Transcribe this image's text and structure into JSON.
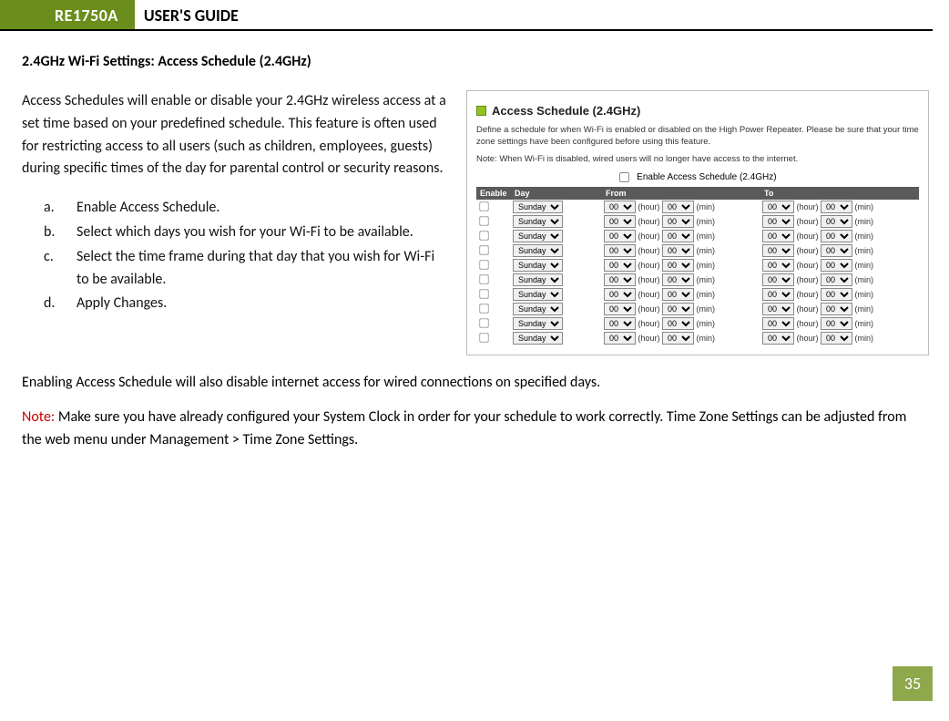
{
  "header": {
    "model": "RE1750A",
    "title": "USER'S GUIDE"
  },
  "section_heading": "2.4GHz Wi-Fi Settings: Access Schedule (2.4GHz)",
  "intro": "Access Schedules will enable or disable your 2.4GHz wireless access at a set time based on your predefined schedule.  This feature is often used for restricting access to all users (such as children, employees, guests) during specific times of the day for parental control or security reasons.",
  "steps": [
    {
      "marker": "a.",
      "text": "Enable Access Schedule."
    },
    {
      "marker": "b.",
      "text": "Select which days you wish for your Wi-Fi to be available."
    },
    {
      "marker": "c.",
      "text": "Select the time frame during that day that you wish for Wi-Fi to be available."
    },
    {
      "marker": "d.",
      "text": "Apply Changes."
    }
  ],
  "lower1": "Enabling Access Schedule will also disable internet access for wired connections on specified days.",
  "note_prefix": "Note:",
  "lower2": "  Make sure you have already configured your System Clock in order for your schedule to work correctly. Time Zone Settings can be adjusted from the web menu under Management > Time Zone Settings.",
  "figure": {
    "title": "Access Schedule (2.4GHz)",
    "desc": "Define a schedule for when Wi-Fi is enabled or disabled on the High Power Repeater. Please be sure that your time zone settings have been configured before using this feature.",
    "note": "Note: When Wi-Fi is disabled, wired users will no longer have access to the internet.",
    "enable_label": "Enable Access Schedule (2.4GHz)",
    "th_enable": "Enable",
    "th_day": "Day",
    "th_from": "From",
    "th_to": "To",
    "row_day": "Sunday",
    "val00": "00",
    "unit_hour": "(hour)",
    "unit_min": "(min)",
    "row_count": 10
  },
  "page_number": "35"
}
